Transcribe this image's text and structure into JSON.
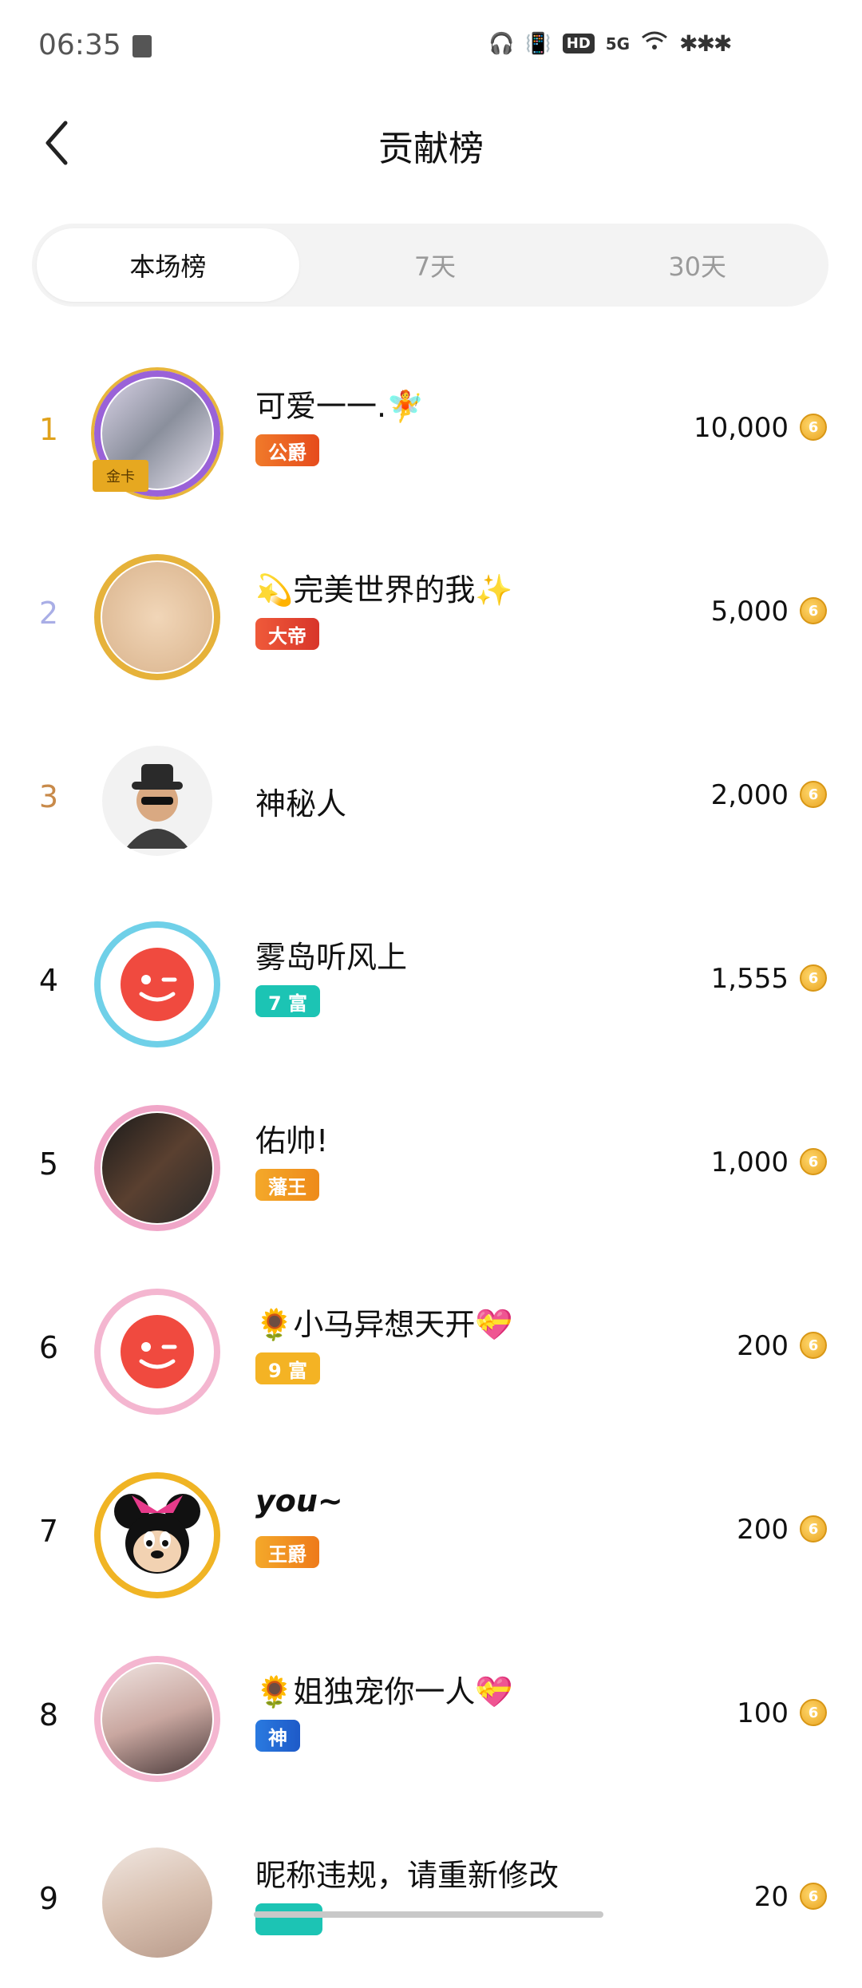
{
  "status_bar": {
    "time": "06:35",
    "hd": "HD",
    "network": "5G",
    "signal_dots": "✱✱✱"
  },
  "header": {
    "title": "贡献榜",
    "back_icon": "chevron-left-icon"
  },
  "tabs": [
    {
      "label": "本场榜",
      "active": true
    },
    {
      "label": "7天",
      "active": false
    },
    {
      "label": "30天",
      "active": false
    }
  ],
  "colors": {
    "rank1": "#e0a21c",
    "rank2": "#a9aee6",
    "rank3": "#c88a4a",
    "coin": "#e9a421"
  },
  "rows": [
    {
      "rank": "1",
      "name": "可爱一一.🧚",
      "badge": "公爵",
      "score": "10,000"
    },
    {
      "rank": "2",
      "name": "💫完美世界的我✨",
      "badge": "大帝",
      "score": "5,000"
    },
    {
      "rank": "3",
      "name": "神秘人",
      "badge": "",
      "score": "2,000"
    },
    {
      "rank": "4",
      "name": "雾岛听风上",
      "badge": "7 富",
      "score": "1,555"
    },
    {
      "rank": "5",
      "name": "佑帅!",
      "badge": "藩王",
      "score": "1,000"
    },
    {
      "rank": "6",
      "name": "🌻小马异想天开💝",
      "badge": "9 富",
      "score": "200"
    },
    {
      "rank": "7",
      "name": "you~",
      "badge": "王爵",
      "score": "200"
    },
    {
      "rank": "8",
      "name": "🌻姐独宠你一人💝",
      "badge": "神",
      "score": "100"
    },
    {
      "rank": "9",
      "name": "昵称违规，请重新修改",
      "badge": "",
      "score": "20"
    }
  ]
}
